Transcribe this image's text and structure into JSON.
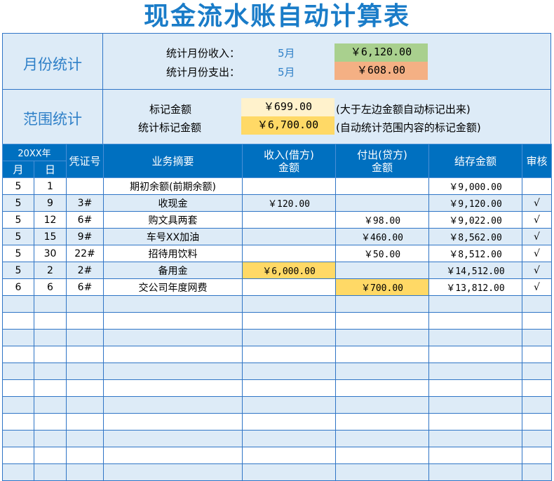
{
  "title": "现金流水账自动计算表",
  "month_stats": {
    "label": "月份统计",
    "income_label": "统计月份收入：",
    "income_month": "5月",
    "income_value": "￥6,120.00",
    "expense_label": "统计月份支出：",
    "expense_month": "5月",
    "expense_value": "￥608.00",
    "colors": {
      "income": "#a9d08e",
      "expense": "#f4b084"
    }
  },
  "range_stats": {
    "label": "范围统计",
    "mark_label": "标记金额",
    "mark_value": "￥699.00",
    "mark_note": "(大于左边金额自动标记出来)",
    "sum_label": "统计标记金额",
    "sum_value": "￥6,700.00",
    "sum_note": "(自动统计范围内容的标记金额)"
  },
  "headers": {
    "year": "20XX年",
    "month": "月",
    "day": "日",
    "voucher": "凭证号",
    "summary": "业务摘要",
    "income1": "收入(借方)",
    "income2": "金额",
    "expense1": "付出(贷方)",
    "expense2": "金额",
    "balance": "结存金额",
    "audit": "审核"
  },
  "rows": [
    {
      "m": "5",
      "d": "1",
      "v": "",
      "s": "期初余额(前期余额)",
      "in": "",
      "out": "",
      "bal": "￥9,000.00",
      "a": ""
    },
    {
      "m": "5",
      "d": "9",
      "v": "3#",
      "s": "收现金",
      "in": "￥120.00",
      "out": "",
      "bal": "￥9,120.00",
      "a": "√"
    },
    {
      "m": "5",
      "d": "12",
      "v": "6#",
      "s": "购文具两套",
      "in": "",
      "out": "￥98.00",
      "bal": "￥9,022.00",
      "a": "√"
    },
    {
      "m": "5",
      "d": "15",
      "v": "9#",
      "s": "车号XX加油",
      "in": "",
      "out": "￥460.00",
      "bal": "￥8,562.00",
      "a": "√"
    },
    {
      "m": "5",
      "d": "30",
      "v": "22#",
      "s": "招待用饮料",
      "in": "",
      "out": "￥50.00",
      "bal": "￥8,512.00",
      "a": "√"
    },
    {
      "m": "5",
      "d": "2",
      "v": "2#",
      "s": "备用金",
      "in": "￥6,000.00",
      "out": "",
      "bal": "￥14,512.00",
      "a": "√"
    },
    {
      "m": "6",
      "d": "6",
      "v": "6#",
      "s": "交公司年度网费",
      "in": "",
      "out": "￥700.00",
      "bal": "￥13,812.00",
      "a": "√"
    }
  ]
}
